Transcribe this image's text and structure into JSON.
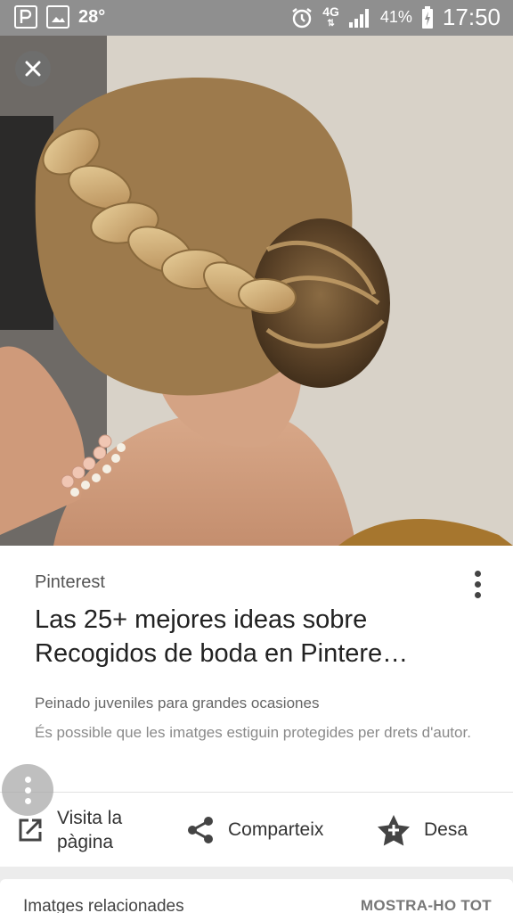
{
  "status_bar": {
    "temperature": "28°",
    "network": "4G",
    "battery": "41%",
    "time": "17:50",
    "icons": [
      "notification-p-icon",
      "gallery-icon",
      "alarm-icon",
      "signal-icon",
      "battery-charging-icon"
    ]
  },
  "viewer": {
    "close_icon": "close-icon",
    "image_subject": "braided-updo-hairstyle-photo"
  },
  "result": {
    "source": "Pinterest",
    "title": "Las 25+ mejores ideas sobre Recogidos de boda en Pintere…",
    "subtitle": "Peinado juveniles para grandes ocasiones",
    "notice": "És possible que les imatges estiguin protegides per drets d'autor."
  },
  "actions": {
    "visit": "Visita la pàgina",
    "share": "Comparteix",
    "save": "Desa"
  },
  "related": {
    "title": "Imatges relacionades",
    "show_all": "MOSTRA-HO TOT"
  },
  "colors": {
    "status_bar": "#8f8f8f",
    "panel": "#ffffff",
    "background": "#ececec"
  }
}
